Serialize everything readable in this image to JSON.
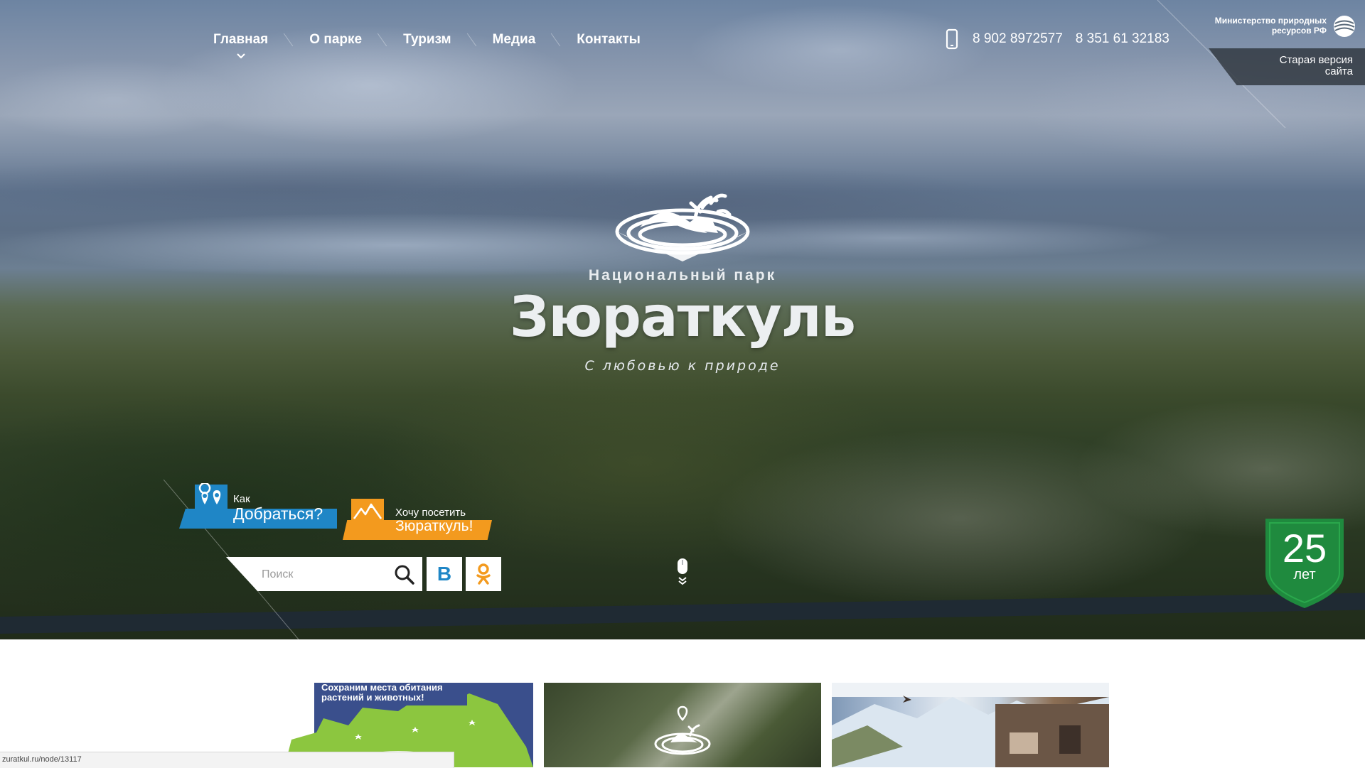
{
  "nav": {
    "items": [
      {
        "label": "Главная"
      },
      {
        "label": "О парке"
      },
      {
        "label": "Туризм"
      },
      {
        "label": "Медиа"
      },
      {
        "label": "Контакты"
      }
    ]
  },
  "contacts": {
    "phone1": "8 902 8972577",
    "phone2": "8 351 61 32183"
  },
  "ministry": {
    "line1": "Министерство природных",
    "line2": "ресурсов РФ"
  },
  "old_version": {
    "line1": "Старая версия",
    "line2": "сайта"
  },
  "hero": {
    "subtitle": "Национальный парк",
    "title": "Зюраткуль",
    "slogan": "С любовью к природе"
  },
  "howto": {
    "small": "Как",
    "big": "Добраться?"
  },
  "visit": {
    "small": "Хочу посетить",
    "big": "Зюраткуль!"
  },
  "search": {
    "placeholder": "Поиск"
  },
  "social": {
    "vk_label": "В"
  },
  "anniversary": {
    "number": "25",
    "label": "лет"
  },
  "cards": {
    "card1_text_line1": "Сохраним места обитания",
    "card1_text_line2": "растений и животных!"
  },
  "status": {
    "url": "zuratkul.ru/node/13117"
  },
  "colors": {
    "howto_blue": "#1f86c6",
    "visit_orange": "#f39a1e",
    "badge_green": "#1f8a3e",
    "ok_orange": "#f39a1e"
  }
}
